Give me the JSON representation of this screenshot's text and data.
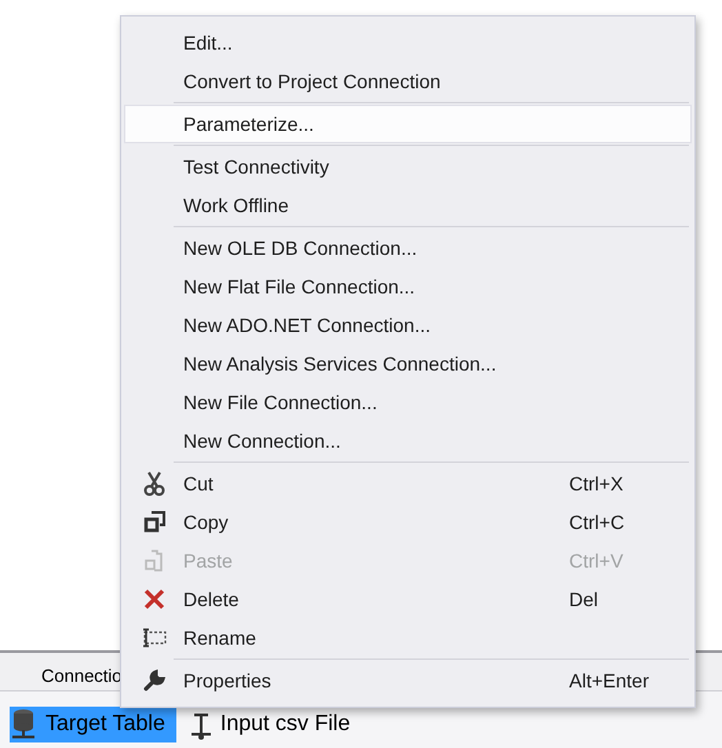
{
  "panel": {
    "tab": "Connectio",
    "items": [
      {
        "label": "Target Table",
        "selected": true,
        "kind": "table"
      },
      {
        "label": "Input csv File",
        "selected": false,
        "kind": "file"
      }
    ]
  },
  "context_menu": {
    "groups": [
      [
        {
          "label": "Edit...",
          "selected": false
        },
        {
          "label": "Convert to Project Connection",
          "selected": false
        }
      ],
      [
        {
          "label": "Parameterize...",
          "selected": true
        }
      ],
      [
        {
          "label": "Test Connectivity",
          "selected": false
        },
        {
          "label": "Work Offline",
          "selected": false
        }
      ],
      [
        {
          "label": "New OLE DB Connection...",
          "selected": false
        },
        {
          "label": "New Flat File Connection...",
          "selected": false
        },
        {
          "label": "New ADO.NET Connection...",
          "selected": false
        },
        {
          "label": "New Analysis Services Connection...",
          "selected": false
        },
        {
          "label": "New File Connection...",
          "selected": false
        },
        {
          "label": "New Connection...",
          "selected": false
        }
      ],
      [
        {
          "label": "Cut",
          "kind": "cut",
          "shortcut": "Ctrl+X",
          "disabled": false,
          "selected": false
        },
        {
          "label": "Copy",
          "kind": "copy",
          "shortcut": "Ctrl+C",
          "disabled": false,
          "selected": false
        },
        {
          "label": "Paste",
          "kind": "paste",
          "shortcut": "Ctrl+V",
          "disabled": true,
          "selected": false
        },
        {
          "label": "Delete",
          "kind": "delete",
          "shortcut": "Del",
          "disabled": false,
          "selected": false
        },
        {
          "label": "Rename",
          "kind": "rename",
          "disabled": false,
          "selected": false
        }
      ],
      [
        {
          "label": "Properties",
          "kind": "properties",
          "shortcut": "Alt+Enter",
          "disabled": false,
          "selected": false
        }
      ]
    ]
  }
}
